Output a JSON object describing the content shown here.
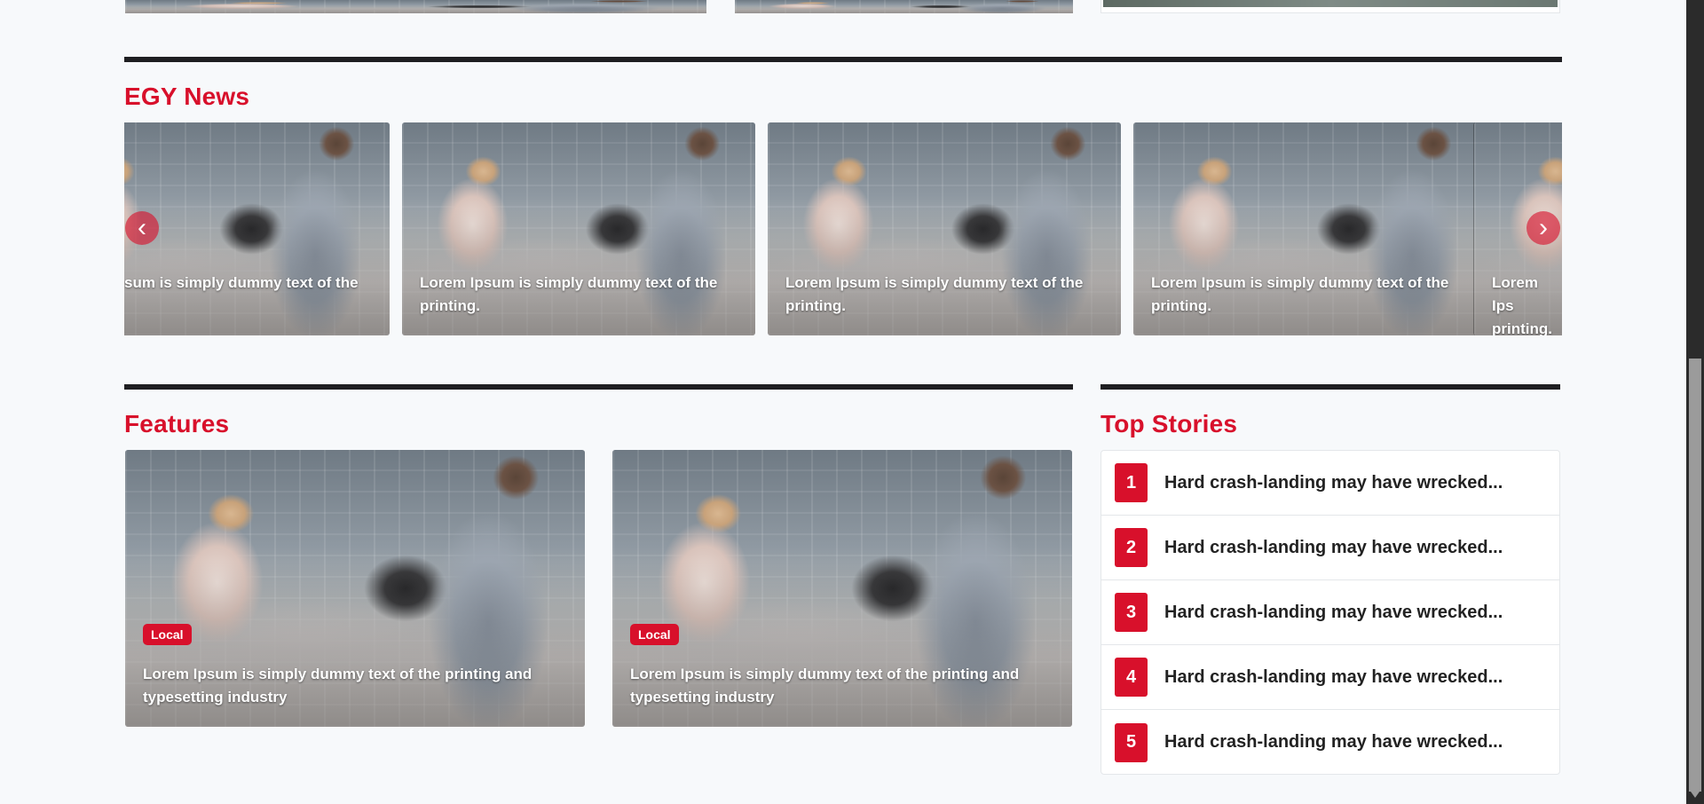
{
  "colors": {
    "accent": "#d8102b",
    "rule": "#1f1f22",
    "background": "#f7f9fb"
  },
  "egy_news": {
    "title": "EGY News",
    "prev_icon": "chevron-left-icon",
    "next_icon": "chevron-right-icon",
    "slides": [
      {
        "caption": "sum is simply dummy text of the"
      },
      {
        "caption": "Lorem Ipsum is simply dummy text of the printing."
      },
      {
        "caption": "Lorem Ipsum is simply dummy text of the printing."
      },
      {
        "caption": "Lorem Ipsum is simply dummy text of the printing."
      },
      {
        "caption": "Lorem Ips printing."
      }
    ]
  },
  "features": {
    "title": "Features",
    "cards": [
      {
        "badge": "Local",
        "caption": "Lorem Ipsum is simply dummy text of the printing and typesetting industry"
      },
      {
        "badge": "Local",
        "caption": "Lorem Ipsum is simply dummy text of the printing and typesetting industry"
      }
    ]
  },
  "top_stories": {
    "title": "Top Stories",
    "items": [
      {
        "rank": "1",
        "title": "Hard crash-landing may have wrecked..."
      },
      {
        "rank": "2",
        "title": "Hard crash-landing may have wrecked..."
      },
      {
        "rank": "3",
        "title": "Hard crash-landing may have wrecked..."
      },
      {
        "rank": "4",
        "title": "Hard crash-landing may have wrecked..."
      },
      {
        "rank": "5",
        "title": "Hard crash-landing may have wrecked..."
      }
    ]
  }
}
